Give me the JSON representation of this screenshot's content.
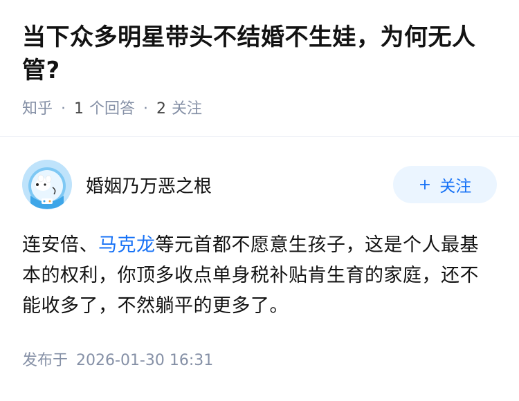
{
  "question": {
    "title": "当下众多明星带头不结婚不生娃，为何无人管?",
    "source": "知乎",
    "answer_count": "1",
    "answer_label": "个回答",
    "follower_count": "2",
    "follower_label": "关注"
  },
  "answer": {
    "author": {
      "name": "婚姻乃万恶之根",
      "avatar_icon": "bear-astronaut-avatar"
    },
    "follow_button": {
      "icon": "plus-icon",
      "label": "关注"
    },
    "content": {
      "part1": "连安倍、",
      "link": "马克龙",
      "part2": "等元首都不愿意生孩子，这是个人最基本的权利，你顶多收点单身税补贴肯生育的家庭，还不能收多了，不然躺平的更多了。"
    },
    "published_label": "发布于",
    "published_date": "2026-01-30 16:31"
  },
  "colors": {
    "accent": "#1772f6",
    "follow_bg": "#ebf5ff",
    "meta_text": "#8590a6"
  }
}
